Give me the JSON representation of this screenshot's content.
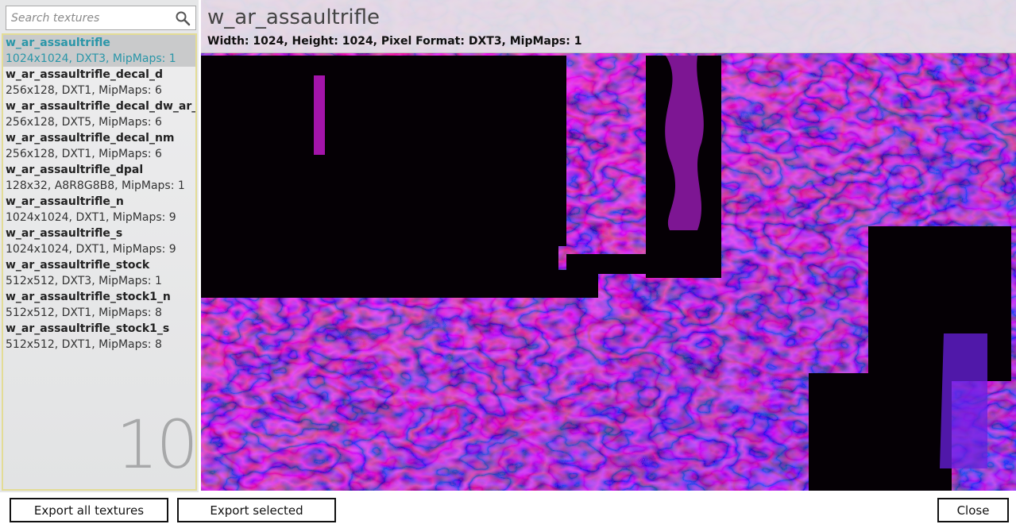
{
  "search": {
    "placeholder": "Search textures",
    "value": ""
  },
  "textures": [
    {
      "name": "w_ar_assaultrifle",
      "meta": "1024x1024, DXT3, MipMaps: 1",
      "selected": true
    },
    {
      "name": "w_ar_assaultrifle_decal_d",
      "meta": "256x128, DXT1, MipMaps: 6"
    },
    {
      "name": "w_ar_assaultrifle_decal_dw_ar_assau",
      "meta": "256x128, DXT5, MipMaps: 6"
    },
    {
      "name": "w_ar_assaultrifle_decal_nm",
      "meta": "256x128, DXT1, MipMaps: 6"
    },
    {
      "name": "w_ar_assaultrifle_dpal",
      "meta": "128x32, A8R8G8B8, MipMaps: 1"
    },
    {
      "name": "w_ar_assaultrifle_n",
      "meta": "1024x1024, DXT1, MipMaps: 9"
    },
    {
      "name": "w_ar_assaultrifle_s",
      "meta": "1024x1024, DXT1, MipMaps: 9"
    },
    {
      "name": "w_ar_assaultrifle_stock",
      "meta": "512x512, DXT3, MipMaps: 1"
    },
    {
      "name": "w_ar_assaultrifle_stock1_n",
      "meta": "512x512, DXT1, MipMaps: 8"
    },
    {
      "name": "w_ar_assaultrifle_stock1_s",
      "meta": "512x512, DXT1, MipMaps: 8"
    }
  ],
  "texture_count": "10",
  "preview": {
    "title": "w_ar_assaultrifle",
    "details": "Width: 1024, Height: 1024, Pixel Format: DXT3, MipMaps: 1"
  },
  "buttons": {
    "export_all": "Export all textures",
    "export_selected": "Export selected",
    "close": "Close"
  },
  "icons": {
    "search": "search-icon"
  },
  "colors": {
    "selection_text": "#2a96a8",
    "selection_bg": "#c9cacb",
    "list_border": "#e3dc96",
    "texture_magenta": "#e020d0",
    "texture_purple": "#7a22e0"
  }
}
